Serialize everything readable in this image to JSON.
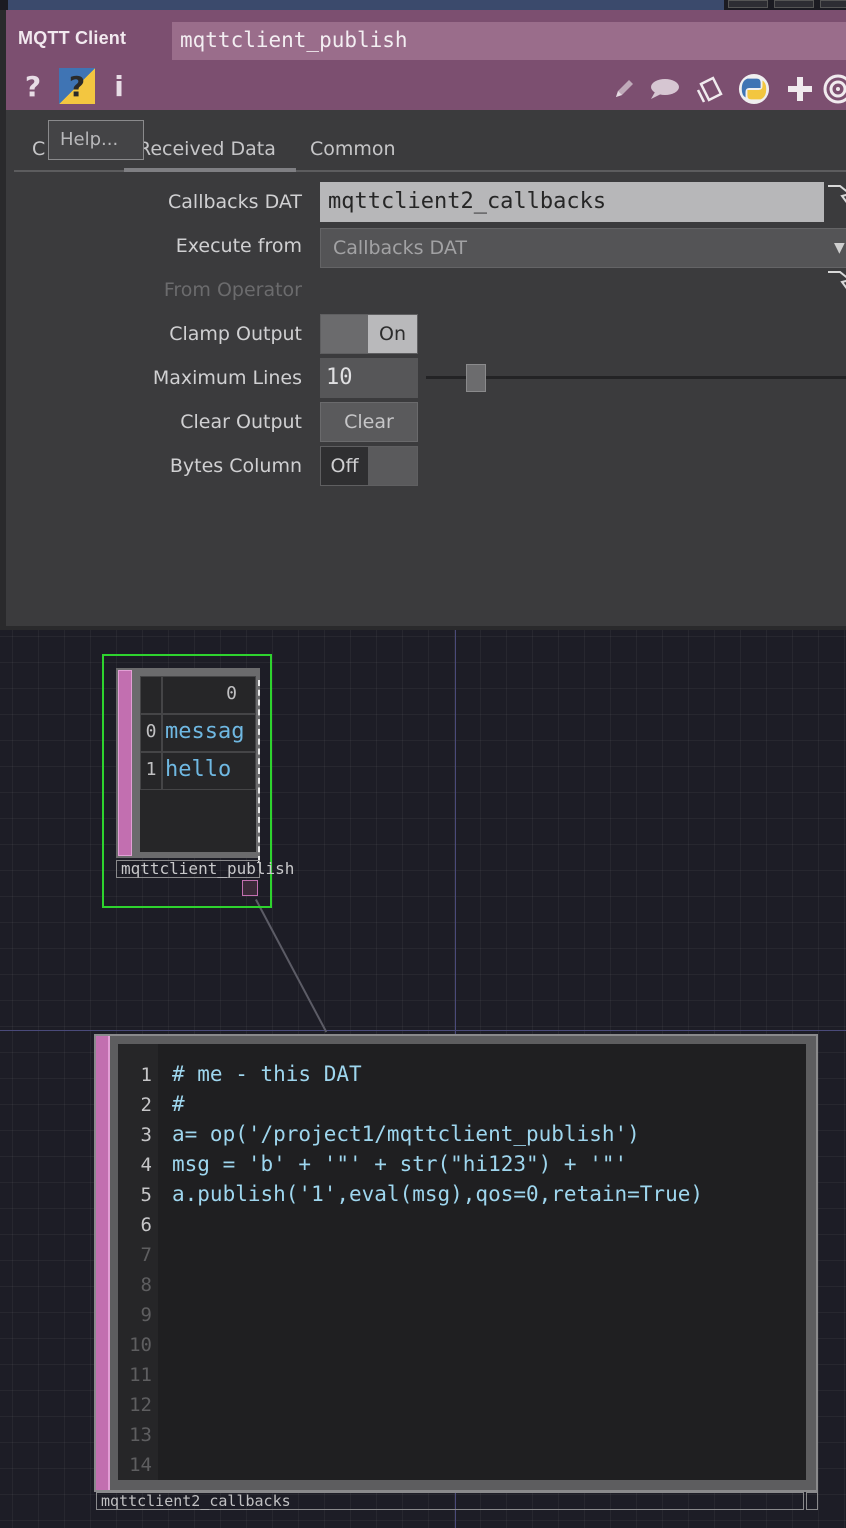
{
  "colors": {
    "header_bg": "#7c4f70",
    "panel_bg": "#3b3b3d",
    "network_bg": "#1d1d26",
    "selected_outline": "#2ed32e",
    "dat_strip": "#c26fb0",
    "code_text": "#9ed6ee",
    "table_value_text": "#6fb8e2"
  },
  "param_window": {
    "op_type": "MQTT Client",
    "op_name": "mqttclient_publish",
    "header_icons": {
      "help": "?",
      "python_help": "?",
      "info": "i",
      "right_icons": [
        "pencil-icon",
        "comment-icon",
        "clone-icon",
        "python-icon",
        "plus-icon",
        "target-icon"
      ]
    },
    "tooltip": "Help...",
    "tabs": [
      {
        "label": "C",
        "name": "connect"
      },
      {
        "label": "Received Data",
        "name": "received-data",
        "active": true
      },
      {
        "label": "Common",
        "name": "common"
      }
    ],
    "params": {
      "callbacks_dat": {
        "label": "Callbacks DAT",
        "value": "mqttclient2_callbacks"
      },
      "execute_from": {
        "label": "Execute from",
        "value": "Callbacks DAT"
      },
      "from_operator": {
        "label": "From Operator"
      },
      "clamp_output": {
        "label": "Clamp Output",
        "value": "On"
      },
      "maximum_lines": {
        "label": "Maximum Lines",
        "value": "10",
        "slider_fraction": 0.1
      },
      "clear_output": {
        "label": "Clear Output",
        "button": "Clear"
      },
      "bytes_column": {
        "label": "Bytes Column",
        "value": "Off"
      }
    }
  },
  "table_node": {
    "name": "mqttclient_publish",
    "header_col": "0",
    "rows": [
      {
        "index": "0",
        "value": "messag"
      },
      {
        "index": "1",
        "value": "hello"
      }
    ]
  },
  "text_node": {
    "name": "mqttclient2_callbacks",
    "line_numbers": [
      "1",
      "2",
      "3",
      "4",
      "5",
      "6",
      "7",
      "8",
      "9",
      "10",
      "11",
      "12",
      "13",
      "14"
    ],
    "code_lines": [
      "# me - this DAT",
      "#",
      "a= op('/project1/mqttclient_publish')",
      "msg = 'b' + '\"' + str(\"hi123\") + '\"'",
      "a.publish('1',eval(msg),qos=0,retain=True)"
    ]
  }
}
